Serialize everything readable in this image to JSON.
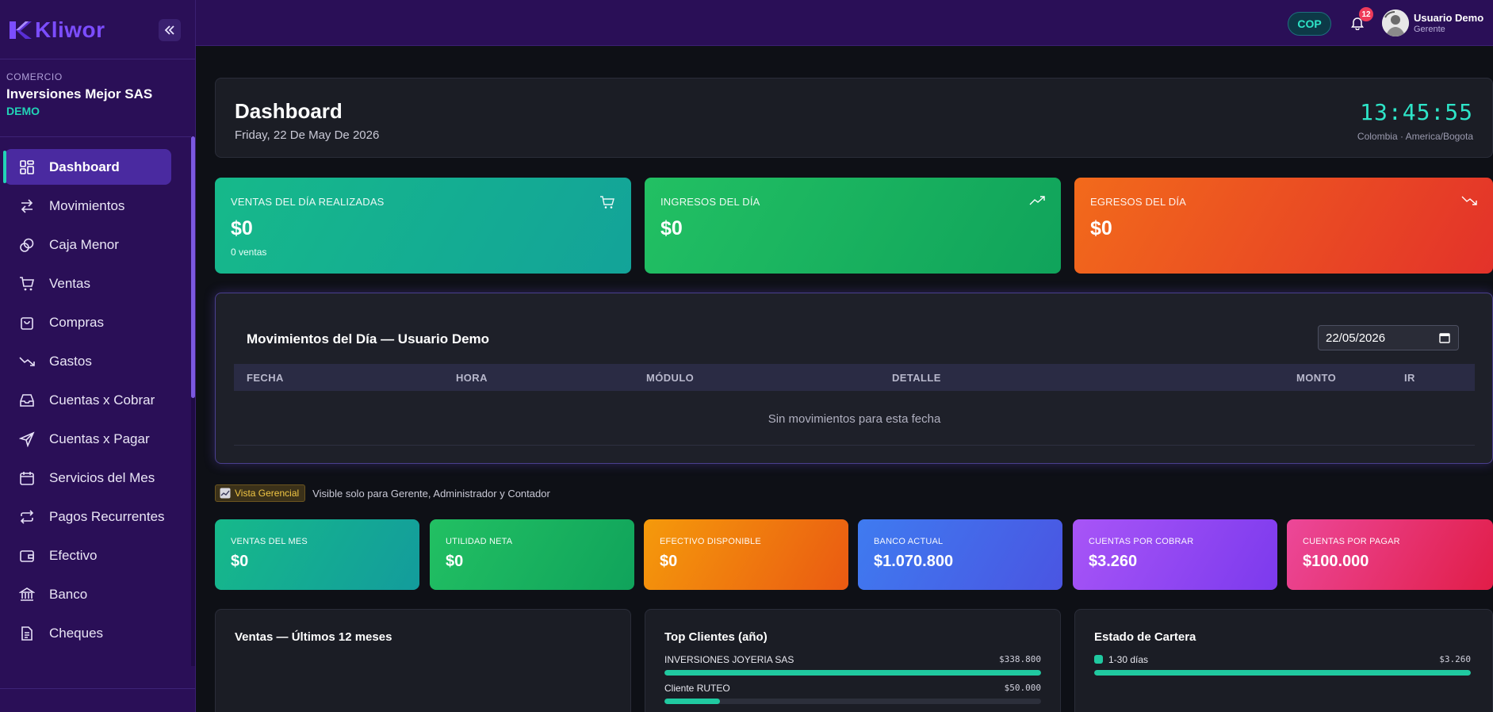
{
  "brand": {
    "name": "Kliwor"
  },
  "company": {
    "label": "COMERCIO",
    "name": "Inversiones Mejor SAS",
    "tag": "DEMO"
  },
  "nav": [
    {
      "label": "Dashboard",
      "icon": "grid-icon",
      "active": true
    },
    {
      "label": "Movimientos",
      "icon": "arrows-swap-icon"
    },
    {
      "label": "Caja Menor",
      "icon": "coins-icon"
    },
    {
      "label": "Ventas",
      "icon": "cart-icon"
    },
    {
      "label": "Compras",
      "icon": "shopping-bag-icon"
    },
    {
      "label": "Gastos",
      "icon": "trending-down-icon"
    },
    {
      "label": "Cuentas x Cobrar",
      "icon": "inbox-icon"
    },
    {
      "label": "Cuentas x Pagar",
      "icon": "send-icon"
    },
    {
      "label": "Servicios del Mes",
      "icon": "calendar-icon"
    },
    {
      "label": "Pagos Recurrentes",
      "icon": "repeat-icon"
    },
    {
      "label": "Efectivo",
      "icon": "wallet-icon"
    },
    {
      "label": "Banco",
      "icon": "bank-icon"
    },
    {
      "label": "Cheques",
      "icon": "document-icon"
    }
  ],
  "topbar": {
    "currency": "COP",
    "notifications": "12",
    "user_name": "Usuario Demo",
    "user_role": "Gerente"
  },
  "header": {
    "title": "Dashboard",
    "date": "Friday, 22 De May De 2026",
    "clock": "13:45:55",
    "timezone": "Colombia · America/Bogota"
  },
  "stats": [
    {
      "label": "VENTAS DEL DÍA REALIZADAS",
      "value": "$0",
      "sub": "0 ventas",
      "icon": "cart-icon"
    },
    {
      "label": "INGRESOS DEL DÍA",
      "value": "$0",
      "icon": "trending-up-icon"
    },
    {
      "label": "EGRESOS DEL DÍA",
      "value": "$0",
      "icon": "trending-down-icon"
    }
  ],
  "movements": {
    "title": "Movimientos del Día — Usuario Demo",
    "date_value": "22/05/2026",
    "columns": [
      "FECHA",
      "HORA",
      "MÓDULO",
      "DETALLE",
      "MONTO",
      "IR"
    ],
    "empty": "Sin movimientos para esta fecha"
  },
  "manager_view": {
    "badge": "Vista Gerencial",
    "note": "Visible solo para Gerente, Administrador y Contador"
  },
  "kpis": [
    {
      "label": "VENTAS DEL MES",
      "value": "$0"
    },
    {
      "label": "UTILIDAD NETA",
      "value": "$0"
    },
    {
      "label": "EFECTIVO DISPONIBLE",
      "value": "$0"
    },
    {
      "label": "BANCO ACTUAL",
      "value": "$1.070.800"
    },
    {
      "label": "CUENTAS POR COBRAR",
      "value": "$3.260"
    },
    {
      "label": "CUENTAS POR PAGAR",
      "value": "$100.000"
    }
  ],
  "panels": {
    "sales_title": "Ventas — Últimos 12 meses",
    "clients_title": "Top Clientes (año)",
    "clients": [
      {
        "name": "INVERSIONES JOYERIA SAS",
        "value": "$338.800",
        "fraction": 1.0
      },
      {
        "name": "Cliente RUTEO",
        "value": "$50.000",
        "fraction": 0.148
      }
    ],
    "portfolio_title": "Estado de Cartera",
    "portfolio": [
      {
        "name": "1-30 días",
        "value": "$3.260",
        "fraction": 1.0
      }
    ]
  },
  "colors": {
    "sidebar_bg": "#2a0f57",
    "accent_teal": "#22d3b6",
    "active_item": "#4a2aa0"
  }
}
